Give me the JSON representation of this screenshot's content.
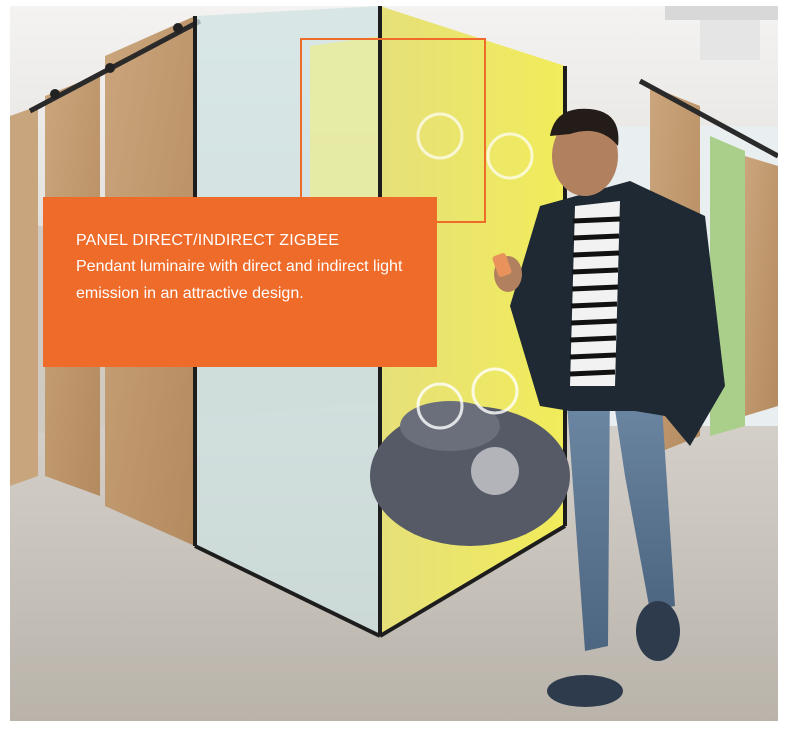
{
  "colors": {
    "accent": "#ee6b2a",
    "text_on_accent": "#ffffff"
  },
  "photo": {
    "description_icon": "office-corridor-photo"
  },
  "callout": {
    "title": "PANEL DIRECT/INDIRECT ZIGBEE",
    "description": "Pendant luminaire with direct and indirect light emission in an attractive design."
  }
}
